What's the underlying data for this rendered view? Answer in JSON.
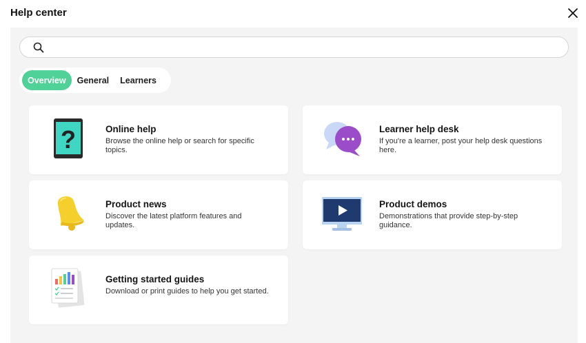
{
  "header": {
    "title": "Help center"
  },
  "search": {
    "placeholder": "",
    "value": ""
  },
  "tabs": [
    {
      "label": "Overview",
      "active": true
    },
    {
      "label": "General",
      "active": false
    },
    {
      "label": "Learners",
      "active": false
    }
  ],
  "cards": [
    {
      "title": "Online help",
      "description": "Browse the online help or search for specific topics.",
      "icon": "tablet-question-icon"
    },
    {
      "title": "Learner help desk",
      "description": "If you're a learner, post your help desk questions here.",
      "icon": "chat-bubbles-icon"
    },
    {
      "title": "Product news",
      "description": "Discover the latest platform features and updates.",
      "icon": "bell-icon"
    },
    {
      "title": "Product demos",
      "description": "Demonstrations that provide step-by-step guidance.",
      "icon": "monitor-play-icon"
    },
    {
      "title": "Getting started guides",
      "description": "Download or print guides to help you get started.",
      "icon": "guide-document-icon"
    }
  ],
  "colors": {
    "accent": "#4fd197",
    "panel_bg": "#f4f4f4",
    "card_bg": "#ffffff"
  }
}
